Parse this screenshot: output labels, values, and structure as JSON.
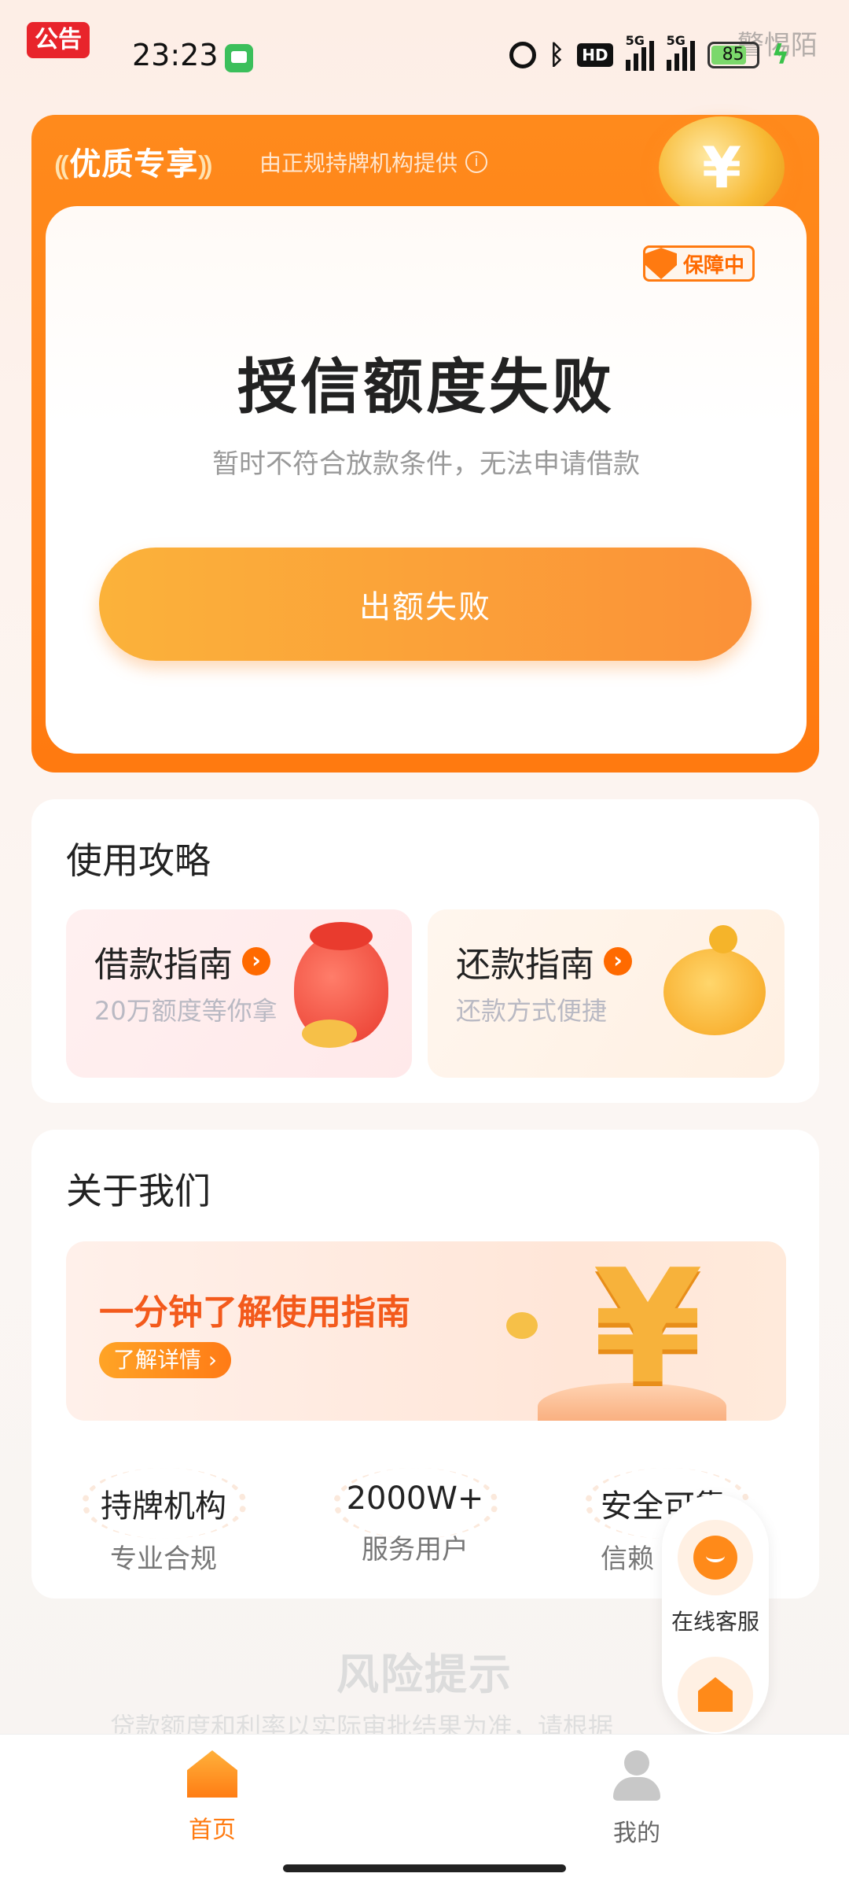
{
  "status_bar": {
    "ad_badge": "公告",
    "time": "23:23",
    "hd_label": "HD",
    "signal1_label": "5G",
    "signal2_label": "5G",
    "battery": "85",
    "watermark": "警惕陌"
  },
  "credit_card": {
    "tab_title": "优质专享",
    "tab_subtitle": "由正规持牌机构提供",
    "coin_symbol": "¥",
    "guard_badge": "保障中",
    "status_title": "授信额度失败",
    "status_subtitle": "暂时不符合放款条件，无法申请借款",
    "action_button": "出额失败"
  },
  "guide": {
    "title": "使用攻略",
    "borrow": {
      "title": "借款指南",
      "subtitle": "20万额度等你拿"
    },
    "repay": {
      "title": "还款指南",
      "subtitle": "还款方式便捷"
    }
  },
  "about": {
    "title": "关于我们",
    "banner_title": "一分钟了解使用指南",
    "banner_button": "了解详情 ›",
    "yen_symbol": "¥",
    "stats": [
      {
        "value": "持牌机构",
        "label": "专业合规"
      },
      {
        "value": "2000W+",
        "label": "服务用户"
      },
      {
        "value": "安全可靠",
        "label": "信赖"
      }
    ]
  },
  "risk": {
    "title": "风险提示",
    "text": "贷款额度和利率以实际审批结果为准，请根据"
  },
  "float_panel": {
    "service_label": "在线客服"
  },
  "bottom_nav": {
    "home": "首页",
    "mine": "我的"
  },
  "colors": {
    "brand_orange": "#ff7a10",
    "button_gradient_start": "#fbb23a",
    "button_gradient_end": "#fb9138"
  }
}
